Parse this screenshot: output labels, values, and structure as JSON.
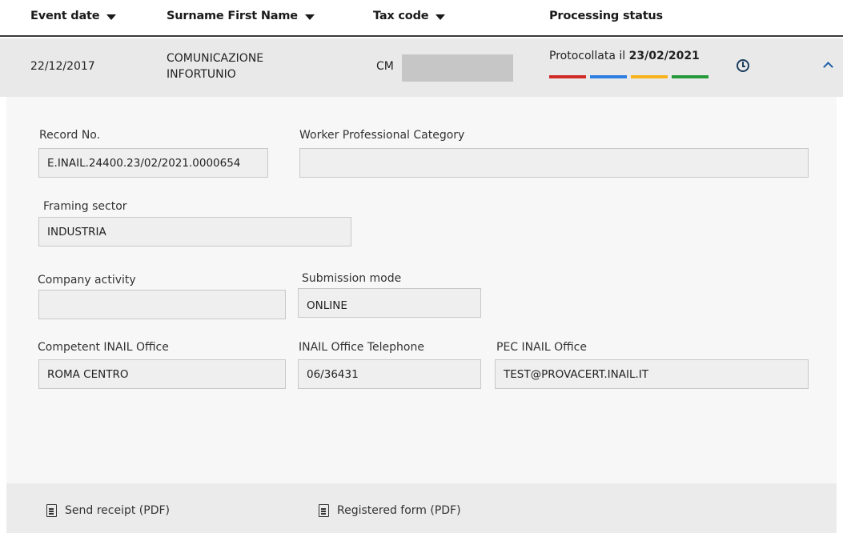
{
  "table": {
    "columns": [
      {
        "label": "Event date",
        "sortable": true
      },
      {
        "label": "Surname First Name",
        "sortable": true
      },
      {
        "label": "Tax code",
        "sortable": true
      },
      {
        "label": "Processing status",
        "sortable": false
      }
    ],
    "row": {
      "event_date": "22/12/2017",
      "name_line1": "COMUNICAZIONE",
      "name_line2": "INFORTUNIO",
      "tax_code": "CM",
      "status_prefix": "Protocollata il ",
      "status_date": "23/02/2021",
      "status_colors": [
        "#cf2b27",
        "#2f7fe0",
        "#f7b21c",
        "#269a3b"
      ]
    }
  },
  "details": {
    "record_no": {
      "label": "Record No.",
      "value": "E.INAIL.24400.23/02/2021.0000654"
    },
    "worker_category": {
      "label": "Worker Professional Category",
      "value": ""
    },
    "framing_sector": {
      "label": "Framing sector",
      "value": "INDUSTRIA"
    },
    "company_activity": {
      "label": "Company activity",
      "value": ""
    },
    "submission_mode": {
      "label": "Submission mode",
      "value": "ONLINE"
    },
    "inail_office": {
      "label": "Competent INAIL Office",
      "value": "ROMA CENTRO"
    },
    "office_phone": {
      "label": "INAIL Office Telephone",
      "value": "06/36431"
    },
    "pec_office": {
      "label": "PEC INAIL Office",
      "value": "TEST@PROVACERT.INAIL.IT"
    }
  },
  "footer": {
    "send_receipt": "Send receipt (PDF)",
    "registered_form": "Registered form (PDF)"
  },
  "icons": {
    "sort": "caret-down-icon",
    "history": "clock-icon",
    "collapse": "chevron-up-icon",
    "document": "document-icon"
  }
}
